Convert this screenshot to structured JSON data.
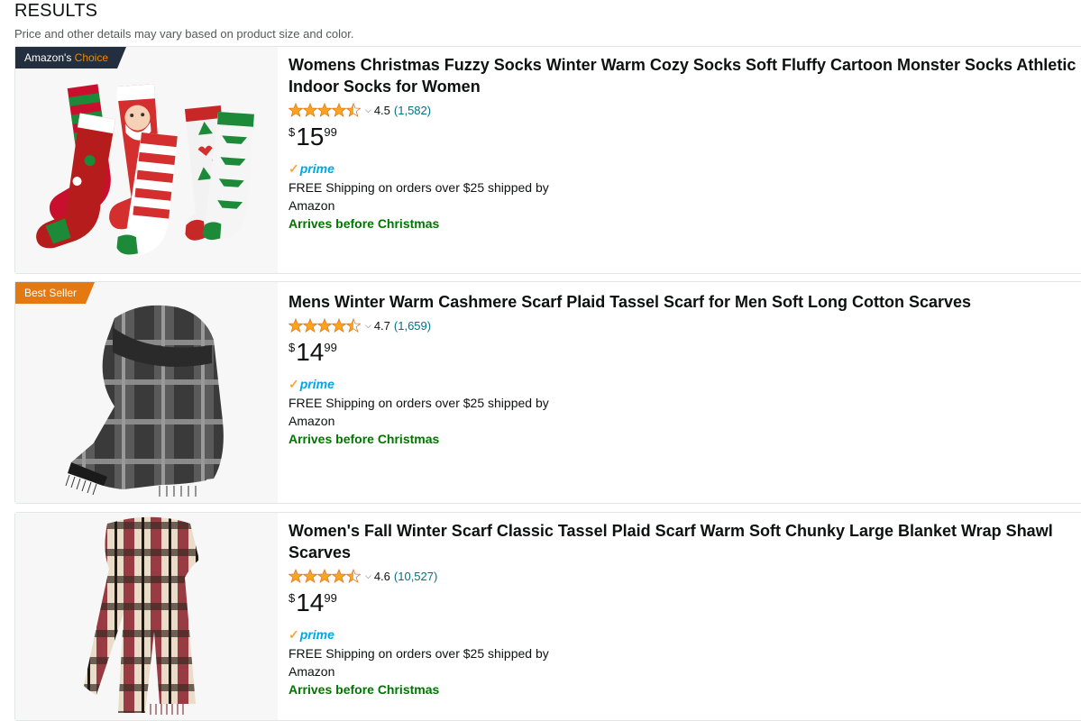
{
  "header": {
    "title": "RESULTS",
    "subtitle": "Price and other details may vary based on product size and color."
  },
  "colors": {
    "link": "#007185",
    "star": "#ffa41c",
    "prime_blue": "#00a8e1",
    "prime_check": "#f3a847",
    "arrives_green": "#007600",
    "choice_badge": "#232f3e",
    "seller_badge": "#e47911"
  },
  "products": [
    {
      "badge_main": "Amazon's",
      "badge_accent": "Choice",
      "title": "Womens Christmas Fuzzy Socks Winter Warm Cozy Socks Soft Fluffy Cartoon Monster Socks Athletic Indoor Socks for Women",
      "rating": "4.5",
      "stars_filled": 4.5,
      "review_count": "(1,582)",
      "price_symbol": "$",
      "price_whole": "15",
      "price_fraction": "99",
      "prime": "prime",
      "shipping": "FREE Shipping on orders over $25 shipped by Amazon",
      "arrives": "Arrives before Christmas",
      "image_icon": "christmas-socks-image"
    },
    {
      "badge_main": "Best Seller",
      "badge_accent": "",
      "title": "Mens Winter Warm Cashmere Scarf Plaid Tassel Scarf for Men Soft Long Cotton Scarves",
      "rating": "4.7",
      "stars_filled": 4.5,
      "review_count": "(1,659)",
      "price_symbol": "$",
      "price_whole": "14",
      "price_fraction": "99",
      "prime": "prime",
      "shipping": "FREE Shipping on orders over $25 shipped by Amazon",
      "arrives": "Arrives before Christmas",
      "image_icon": "grey-scarf-image"
    },
    {
      "badge_main": "",
      "badge_accent": "",
      "title": "Women's Fall Winter Scarf Classic Tassel Plaid Scarf Warm Soft Chunky Large Blanket Wrap Shawl Scarves",
      "rating": "4.6",
      "stars_filled": 4.5,
      "review_count": "(10,527)",
      "price_symbol": "$",
      "price_whole": "14",
      "price_fraction": "99",
      "prime": "prime",
      "shipping": "FREE Shipping on orders over $25 shipped by Amazon",
      "arrives": "Arrives before Christmas",
      "image_icon": "plaid-scarf-image"
    }
  ]
}
